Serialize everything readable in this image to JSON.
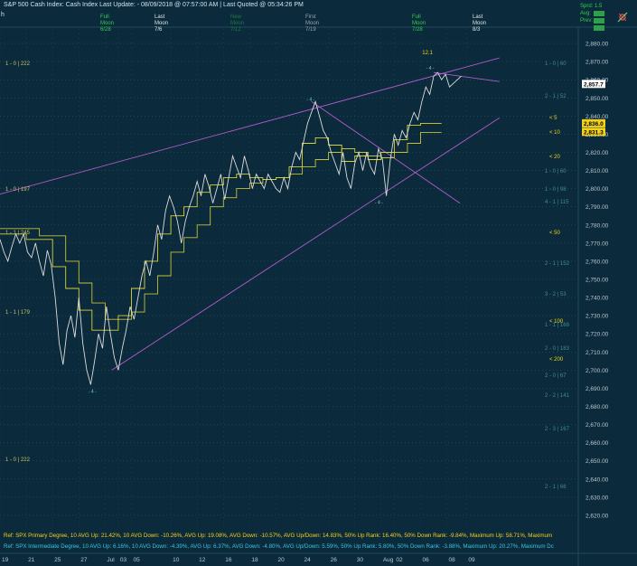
{
  "header": {
    "title": "S&P 500 Cash Index:  Cash Index  Last Update: - 08/09/2018 @ 07:57:00 AM | Last Quoted @ 05:34:26 PM",
    "left_marker": "h"
  },
  "moon_markers": [
    {
      "phase": "Full",
      "word": "Moon",
      "date": "6/28",
      "color": "#33d04d"
    },
    {
      "phase": "Last",
      "word": "Moon",
      "date": "7/6",
      "color": "#e6e6e6"
    },
    {
      "phase": "New",
      "word": "Moon",
      "date": "7/12",
      "color": "#1f7a3c"
    },
    {
      "phase": "First",
      "word": "Moon",
      "date": "7/19",
      "color": "#9aa5ab"
    },
    {
      "phase": "Full",
      "word": "Moon",
      "date": "7/28",
      "color": "#33d04d"
    },
    {
      "phase": "Last",
      "word": "Moon",
      "date": "8/3",
      "color": "#e6e6e6"
    }
  ],
  "top_right": {
    "spread": "Sprd: 1.5",
    "avg": "Avg: ",
    "prev": "Prev: ",
    "icon": "gear-pen-icon"
  },
  "chart_data": {
    "type": "line",
    "y_range": [
      2612,
      2888
    ],
    "y_ticks": [
      "2,880.00",
      "2,870.00",
      "2,860.00",
      "2,850.00",
      "2,840.00",
      "2,830.00",
      "2,820.00",
      "2,810.00",
      "2,800.00",
      "2,790.00",
      "2,780.00",
      "2,770.00",
      "2,760.00",
      "2,750.00",
      "2,740.00",
      "2,730.00",
      "2,720.00",
      "2,710.00",
      "2,700.00",
      "2,690.00",
      "2,680.00",
      "2,670.00",
      "2,660.00",
      "2,650.00",
      "2,640.00",
      "2,630.00",
      "2,620.00"
    ],
    "y_tick_values": [
      2880,
      2870,
      2860,
      2850,
      2840,
      2830,
      2820,
      2810,
      2800,
      2790,
      2780,
      2770,
      2760,
      2750,
      2740,
      2730,
      2720,
      2710,
      2700,
      2690,
      2680,
      2670,
      2660,
      2650,
      2640,
      2630,
      2620
    ],
    "x_range": [
      0,
      44
    ],
    "x_ticks": [
      {
        "label": "19",
        "x": 0
      },
      {
        "label": "21",
        "x": 2
      },
      {
        "label": "25",
        "x": 4
      },
      {
        "label": "27",
        "x": 6
      },
      {
        "label": "Jul",
        "x": 8
      },
      {
        "label": "03",
        "x": 9
      },
      {
        "label": "05",
        "x": 10
      },
      {
        "label": "10",
        "x": 13
      },
      {
        "label": "12",
        "x": 15
      },
      {
        "label": "16",
        "x": 17
      },
      {
        "label": "18",
        "x": 19
      },
      {
        "label": "20",
        "x": 21
      },
      {
        "label": "24",
        "x": 23
      },
      {
        "label": "26",
        "x": 25
      },
      {
        "label": "30",
        "x": 27
      },
      {
        "label": "Aug",
        "x": 29
      },
      {
        "label": "02",
        "x": 30
      },
      {
        "label": "06",
        "x": 32
      },
      {
        "label": "08",
        "x": 34
      },
      {
        "label": "09",
        "x": 35.5
      }
    ],
    "price_series": [
      [
        0,
        2772
      ],
      [
        0.3,
        2765
      ],
      [
        0.6,
        2760
      ],
      [
        0.9,
        2768
      ],
      [
        1.2,
        2775
      ],
      [
        1.5,
        2770
      ],
      [
        1.8,
        2775
      ],
      [
        2.1,
        2765
      ],
      [
        2.4,
        2762
      ],
      [
        2.7,
        2770
      ],
      [
        3,
        2760
      ],
      [
        3.3,
        2752
      ],
      [
        3.6,
        2766
      ],
      [
        3.9,
        2758
      ],
      [
        4.2,
        2740
      ],
      [
        4.5,
        2715
      ],
      [
        4.8,
        2703
      ],
      [
        5.1,
        2722
      ],
      [
        5.4,
        2730
      ],
      [
        5.7,
        2718
      ],
      [
        6,
        2740
      ],
      [
        6.3,
        2715
      ],
      [
        6.6,
        2700
      ],
      [
        6.9,
        2692
      ],
      [
        7.2,
        2705
      ],
      [
        7.5,
        2720
      ],
      [
        7.8,
        2712
      ],
      [
        8.1,
        2735
      ],
      [
        8.4,
        2720
      ],
      [
        8.7,
        2707
      ],
      [
        9,
        2700
      ],
      [
        9.3,
        2712
      ],
      [
        9.6,
        2722
      ],
      [
        9.9,
        2735
      ],
      [
        10.2,
        2728
      ],
      [
        10.5,
        2740
      ],
      [
        10.8,
        2752
      ],
      [
        11.1,
        2760
      ],
      [
        11.4,
        2752
      ],
      [
        11.7,
        2765
      ],
      [
        12,
        2780
      ],
      [
        12.3,
        2772
      ],
      [
        12.6,
        2788
      ],
      [
        12.9,
        2796
      ],
      [
        13.2,
        2790
      ],
      [
        13.5,
        2782
      ],
      [
        13.8,
        2770
      ],
      [
        14.1,
        2782
      ],
      [
        14.4,
        2790
      ],
      [
        14.7,
        2796
      ],
      [
        15,
        2804
      ],
      [
        15.3,
        2796
      ],
      [
        15.6,
        2808
      ],
      [
        15.9,
        2801
      ],
      [
        16.2,
        2792
      ],
      [
        16.5,
        2800
      ],
      [
        16.8,
        2808
      ],
      [
        17.1,
        2794
      ],
      [
        17.4,
        2806
      ],
      [
        17.7,
        2818
      ],
      [
        18,
        2812
      ],
      [
        18.3,
        2806
      ],
      [
        18.6,
        2818
      ],
      [
        18.9,
        2810
      ],
      [
        19.2,
        2800
      ],
      [
        19.5,
        2808
      ],
      [
        19.8,
        2804
      ],
      [
        20.1,
        2800
      ],
      [
        20.4,
        2808
      ],
      [
        20.7,
        2804
      ],
      [
        21,
        2800
      ],
      [
        21.3,
        2798
      ],
      [
        21.6,
        2806
      ],
      [
        21.9,
        2800
      ],
      [
        22.2,
        2812
      ],
      [
        22.5,
        2820
      ],
      [
        22.8,
        2816
      ],
      [
        23.1,
        2826
      ],
      [
        23.4,
        2836
      ],
      [
        23.7,
        2842
      ],
      [
        24,
        2848
      ],
      [
        24.3,
        2840
      ],
      [
        24.6,
        2832
      ],
      [
        24.9,
        2828
      ],
      [
        25.2,
        2820
      ],
      [
        25.5,
        2814
      ],
      [
        25.8,
        2808
      ],
      [
        26.1,
        2820
      ],
      [
        26.4,
        2806
      ],
      [
        26.7,
        2800
      ],
      [
        27,
        2814
      ],
      [
        27.3,
        2820
      ],
      [
        27.6,
        2810
      ],
      [
        27.9,
        2820
      ],
      [
        28.2,
        2812
      ],
      [
        28.5,
        2808
      ],
      [
        28.8,
        2822
      ],
      [
        29.1,
        2816
      ],
      [
        29.4,
        2796
      ],
      [
        29.7,
        2816
      ],
      [
        30,
        2830
      ],
      [
        30.3,
        2824
      ],
      [
        30.6,
        2832
      ],
      [
        30.9,
        2828
      ],
      [
        31.2,
        2836
      ],
      [
        31.5,
        2842
      ],
      [
        31.8,
        2838
      ],
      [
        32.1,
        2848
      ],
      [
        32.4,
        2856
      ],
      [
        32.7,
        2852
      ],
      [
        33,
        2862
      ],
      [
        33.3,
        2864
      ],
      [
        33.6,
        2860
      ],
      [
        33.9,
        2863
      ],
      [
        34.2,
        2856
      ],
      [
        34.5,
        2858
      ],
      [
        34.8,
        2860
      ],
      [
        35.1,
        2862
      ]
    ],
    "price_tag": "2,857.7",
    "avg_tag_5": "2,836.0",
    "avg_tag_10": "2,831.3",
    "ma_5": [
      [
        0,
        2775
      ],
      [
        2,
        2775
      ],
      [
        2,
        2772
      ],
      [
        4,
        2772
      ],
      [
        4,
        2757
      ],
      [
        5,
        2757
      ],
      [
        5,
        2745
      ],
      [
        6,
        2745
      ],
      [
        6,
        2733
      ],
      [
        7,
        2733
      ],
      [
        7,
        2722
      ],
      [
        8,
        2722
      ],
      [
        8,
        2722
      ],
      [
        9,
        2722
      ],
      [
        9,
        2730
      ],
      [
        10,
        2730
      ],
      [
        10,
        2745
      ],
      [
        11,
        2745
      ],
      [
        11,
        2760
      ],
      [
        12,
        2760
      ],
      [
        12,
        2775
      ],
      [
        13,
        2775
      ],
      [
        13,
        2785
      ],
      [
        14,
        2785
      ],
      [
        14,
        2790
      ],
      [
        15,
        2790
      ],
      [
        15,
        2798
      ],
      [
        16,
        2798
      ],
      [
        16,
        2802
      ],
      [
        17,
        2802
      ],
      [
        17,
        2806
      ],
      [
        18,
        2806
      ],
      [
        18,
        2808
      ],
      [
        19,
        2808
      ],
      [
        19,
        2806
      ],
      [
        20,
        2806
      ],
      [
        20,
        2805
      ],
      [
        21,
        2805
      ],
      [
        21,
        2806
      ],
      [
        22,
        2806
      ],
      [
        22,
        2812
      ],
      [
        23,
        2812
      ],
      [
        23,
        2825
      ],
      [
        24,
        2825
      ],
      [
        24,
        2828
      ],
      [
        25,
        2828
      ],
      [
        25,
        2824
      ],
      [
        26,
        2824
      ],
      [
        26,
        2815
      ],
      [
        27,
        2815
      ],
      [
        27,
        2818
      ],
      [
        28,
        2818
      ],
      [
        28,
        2816
      ],
      [
        29,
        2816
      ],
      [
        29,
        2820
      ],
      [
        30,
        2820
      ],
      [
        30,
        2827
      ],
      [
        31,
        2827
      ],
      [
        31,
        2835
      ],
      [
        32,
        2835
      ],
      [
        32,
        2836
      ],
      [
        33.6,
        2836
      ]
    ],
    "ma_10": [
      [
        0,
        2778
      ],
      [
        3,
        2778
      ],
      [
        3,
        2774
      ],
      [
        5,
        2774
      ],
      [
        5,
        2760
      ],
      [
        6,
        2760
      ],
      [
        6,
        2748
      ],
      [
        7,
        2748
      ],
      [
        7,
        2737
      ],
      [
        8,
        2737
      ],
      [
        8,
        2728
      ],
      [
        9,
        2728
      ],
      [
        9,
        2728
      ],
      [
        10,
        2728
      ],
      [
        10,
        2732
      ],
      [
        11,
        2732
      ],
      [
        11,
        2742
      ],
      [
        12,
        2742
      ],
      [
        12,
        2752
      ],
      [
        13,
        2752
      ],
      [
        13,
        2765
      ],
      [
        14,
        2765
      ],
      [
        14,
        2773
      ],
      [
        15,
        2773
      ],
      [
        15,
        2780
      ],
      [
        16,
        2780
      ],
      [
        16,
        2790
      ],
      [
        17,
        2790
      ],
      [
        17,
        2795
      ],
      [
        18,
        2795
      ],
      [
        18,
        2800
      ],
      [
        19,
        2800
      ],
      [
        19,
        2803
      ],
      [
        20,
        2803
      ],
      [
        20,
        2805
      ],
      [
        21,
        2805
      ],
      [
        21,
        2806
      ],
      [
        22,
        2806
      ],
      [
        22,
        2808
      ],
      [
        23,
        2808
      ],
      [
        23,
        2812
      ],
      [
        24,
        2812
      ],
      [
        24,
        2816
      ],
      [
        25,
        2816
      ],
      [
        25,
        2820
      ],
      [
        26,
        2820
      ],
      [
        26,
        2822
      ],
      [
        27,
        2822
      ],
      [
        27,
        2820
      ],
      [
        28,
        2820
      ],
      [
        28,
        2818
      ],
      [
        29,
        2818
      ],
      [
        29,
        2817
      ],
      [
        30,
        2817
      ],
      [
        30,
        2820
      ],
      [
        31,
        2820
      ],
      [
        31,
        2825
      ],
      [
        32,
        2825
      ],
      [
        32,
        2831
      ],
      [
        33.6,
        2831
      ]
    ],
    "trendlines": [
      {
        "from": [
          0,
          2797
        ],
        "to": [
          38,
          2872
        ],
        "color": "#b25bc8"
      },
      {
        "from": [
          33,
          2864
        ],
        "to": [
          38,
          2859
        ],
        "color": "#b25bc8"
      },
      {
        "from": [
          8.5,
          2700
        ],
        "to": [
          38,
          2839
        ],
        "color": "#b25bc8"
      },
      {
        "from": [
          23.7,
          2848
        ],
        "to": [
          35,
          2792
        ],
        "color": "#b25bc8"
      }
    ],
    "peak_label": "12.1",
    "pivot_markers": [
      {
        "x": 7.0,
        "y": 2689,
        "label": "- 4 -"
      },
      {
        "x": 23.6,
        "y": 2850,
        "label": "- 4 -"
      },
      {
        "x": 28.8,
        "y": 2793,
        "label": "- 4 -"
      },
      {
        "x": 32.7,
        "y": 2867,
        "label": "- 4 -"
      }
    ],
    "gann_left": [
      {
        "label": "1 - 0 | 222",
        "y": 2868
      },
      {
        "label": "1 - 0 | 197",
        "y": 2799
      },
      {
        "label": "1 - 1 | 245",
        "y": 2775
      },
      {
        "label": "1 - 1 | 179",
        "y": 2731
      },
      {
        "label": "1 - 0 | 222",
        "y": 2650
      }
    ],
    "gann_right": [
      {
        "label": "1 - 0 | 60",
        "y": 2868
      },
      {
        "label": "2 - 1 | 52",
        "y": 2850
      },
      {
        "label": "1 - 0 | 60",
        "y": 2809
      },
      {
        "label": "1 - 0 | 98",
        "y": 2799
      },
      {
        "label": "4 - 1 | 115",
        "y": 2792
      },
      {
        "label": "2 - 1 | 152",
        "y": 2758
      },
      {
        "label": "3 - 2 | 53",
        "y": 2741
      },
      {
        "label": "1 - 1 | 168",
        "y": 2724
      },
      {
        "label": "2 - 0 | 183",
        "y": 2711
      },
      {
        "label": "2 - 0 | 67",
        "y": 2696
      },
      {
        "label": "2 - 2 | 141",
        "y": 2685
      },
      {
        "label": "2 - 3 | 167",
        "y": 2667
      },
      {
        "label": "2 - 1 | 66",
        "y": 2635
      }
    ],
    "avg_labels": [
      {
        "label": "< 5",
        "y": 2838
      },
      {
        "label": "< 10",
        "y": 2830
      },
      {
        "label": "< 20",
        "y": 2817
      },
      {
        "label": "< 50",
        "y": 2775
      },
      {
        "label": "< 100",
        "y": 2726
      },
      {
        "label": "< 200",
        "y": 2705
      }
    ]
  },
  "ref_lines": [
    {
      "text": "Ref: SPX Primary Degree, 10 AVG Up: 21.42%, 10 AVG Down: -10.26%, AVG Up: 19.08%, AVG Down: -10.57%, AVG Up/Down: 14.83%, 50%  Up Rank: 16.40%, 50% Down Rank: -9.84%, Maximum Up: 58.71%, Maximum",
      "color": "#f2d21f"
    },
    {
      "text": "Ref: SPX Intermediate Degree, 10 AVG Up: 6.16%, 10 AVG Down: -4.39%, AVG Up: 6.37%, AVG Down: -4.80%, AVG Up/Down: 5.59%, 50%  Up Rank: 5.80%, 50% Down Rank: -3.88%, Maximum Up: 20.27%, Maximum Dc",
      "color": "#39c6dc"
    }
  ],
  "colors": {
    "background": "#0b2a3c",
    "price": "#dcdcdc",
    "ma": "#d8d23a",
    "trend": "#b25bc8",
    "grid_dots": "#2c5366",
    "axis_text": "#b9c6cd",
    "tag_yellow": "#f2d21f",
    "tag_white": "#ffffff"
  }
}
